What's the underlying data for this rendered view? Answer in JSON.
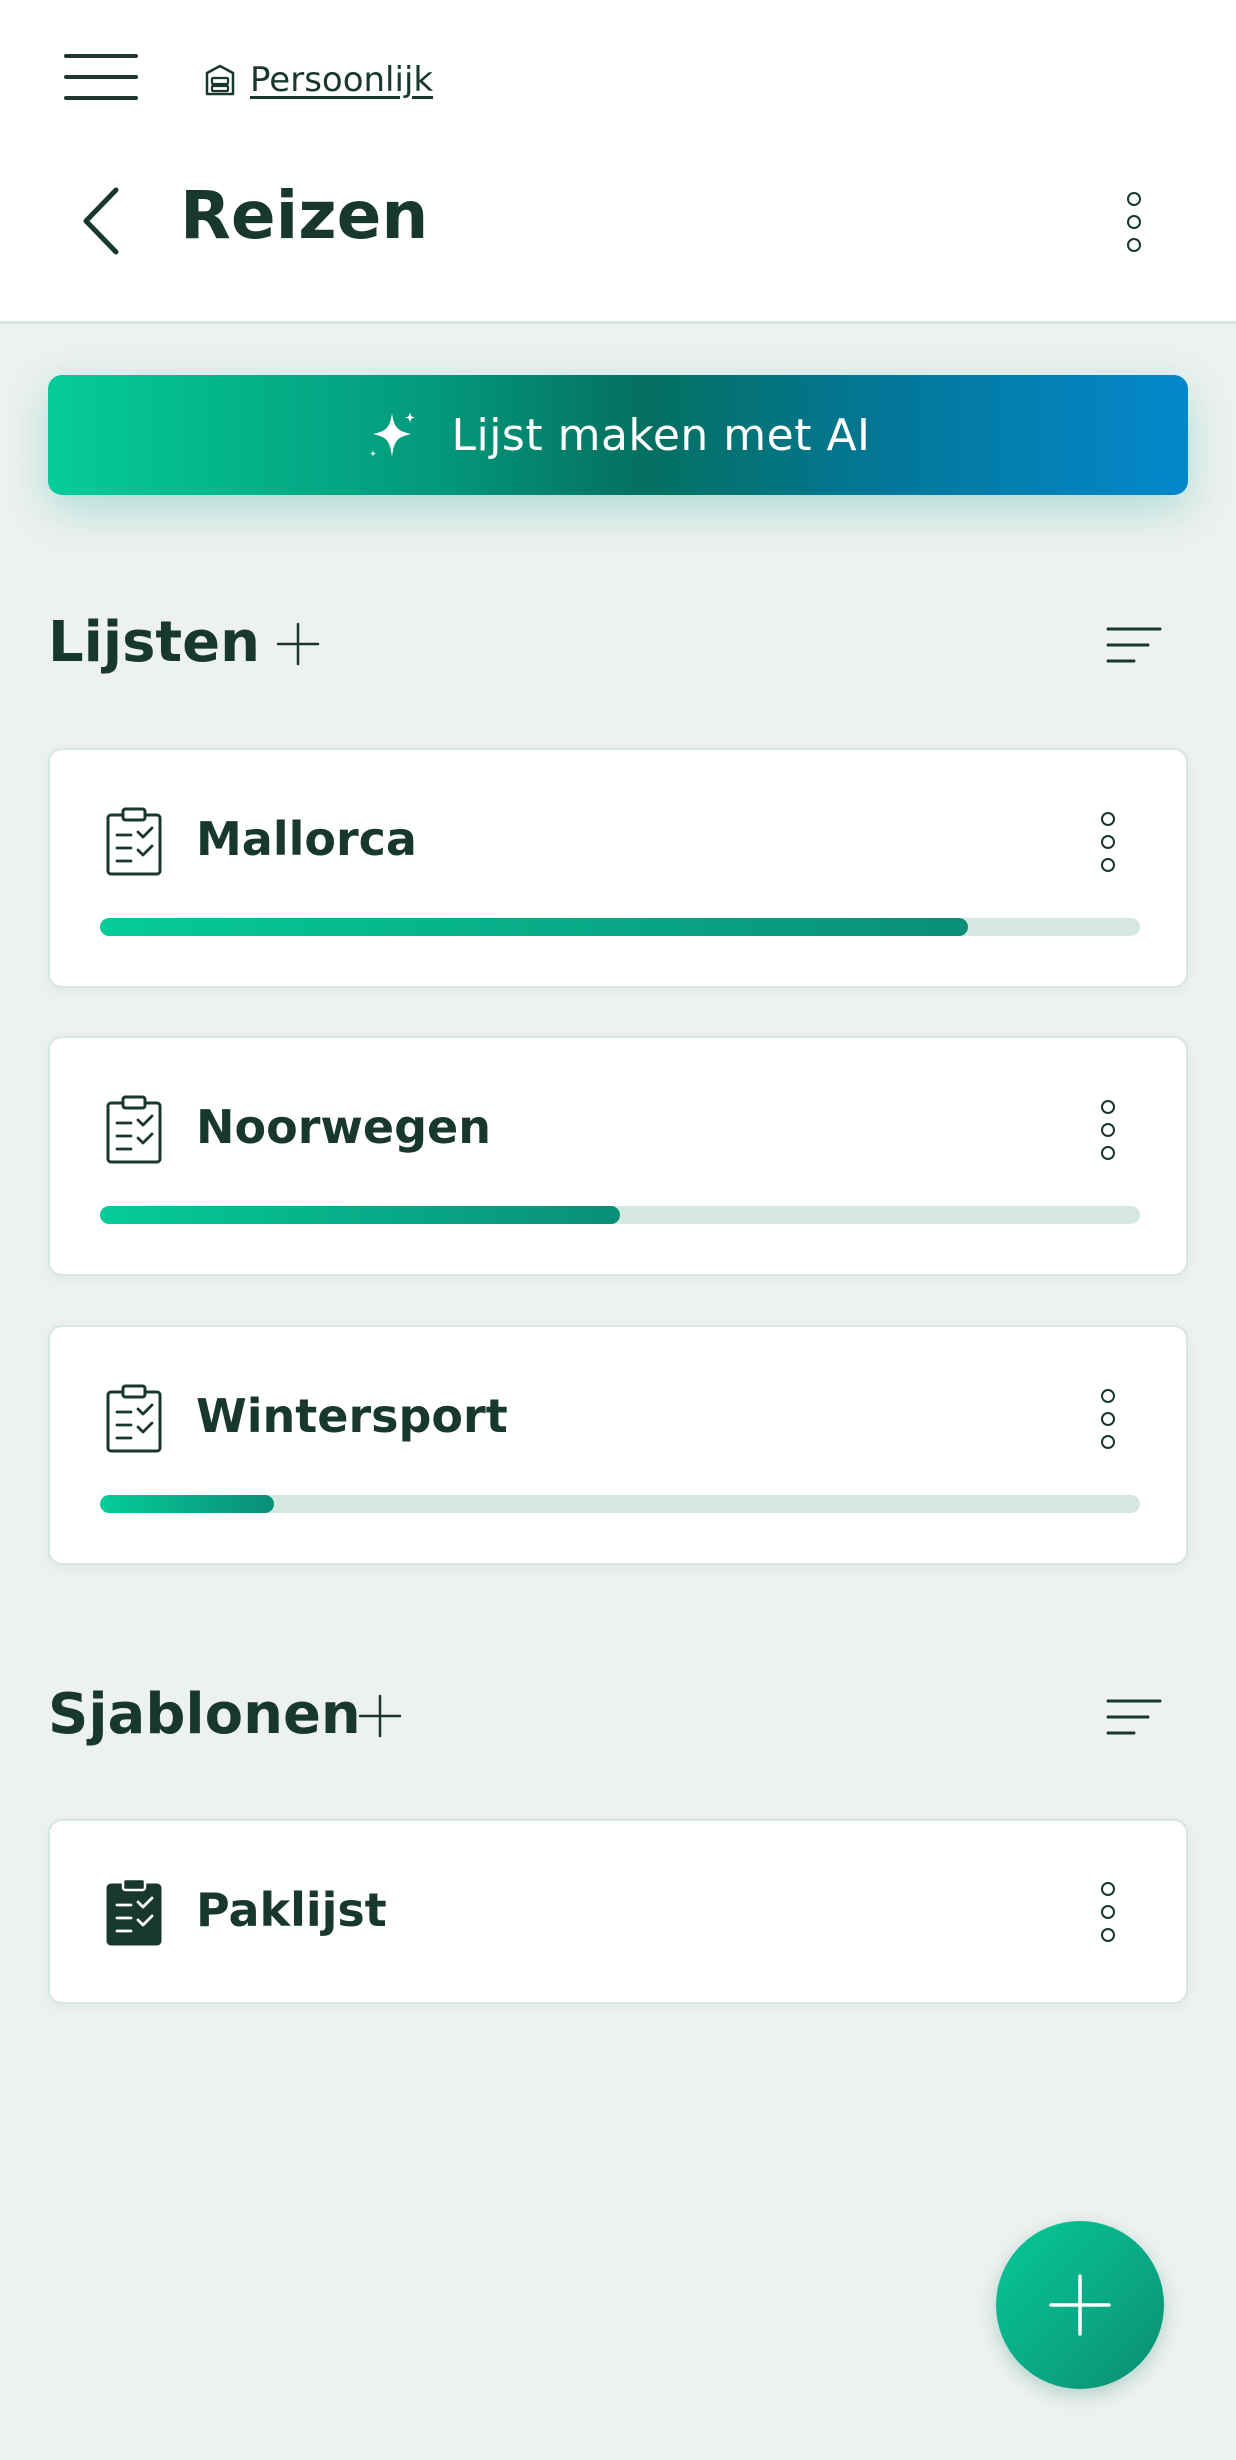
{
  "header": {
    "breadcrumb": "Persoonlijk",
    "title": "Reizen"
  },
  "ai_button": {
    "label": "Lijst maken met AI"
  },
  "lists_section": {
    "title": "Lijsten",
    "items": [
      {
        "name": "Mallorca",
        "progress": 0.835
      },
      {
        "name": "Noorwegen",
        "progress": 0.5
      },
      {
        "name": "Wintersport",
        "progress": 0.167
      }
    ]
  },
  "templates_section": {
    "title": "Sjablonen",
    "items": [
      {
        "name": "Paklijst"
      }
    ]
  },
  "colors": {
    "brand_dark": "#17382a",
    "accent_start": "#05cc98",
    "accent_end": "#0488cc",
    "progress_track": "#d6e9e0",
    "background": "#edf1ef"
  },
  "icons": {
    "menu": "hamburger-icon",
    "breadcrumb": "box-icon",
    "back": "chevron-left-icon",
    "more": "kebab-icon",
    "ai": "sparkles-icon",
    "add": "plus-icon",
    "sort": "sort-lines-icon",
    "list": "clipboard-check-icon",
    "template": "clipboard-check-filled-icon"
  }
}
